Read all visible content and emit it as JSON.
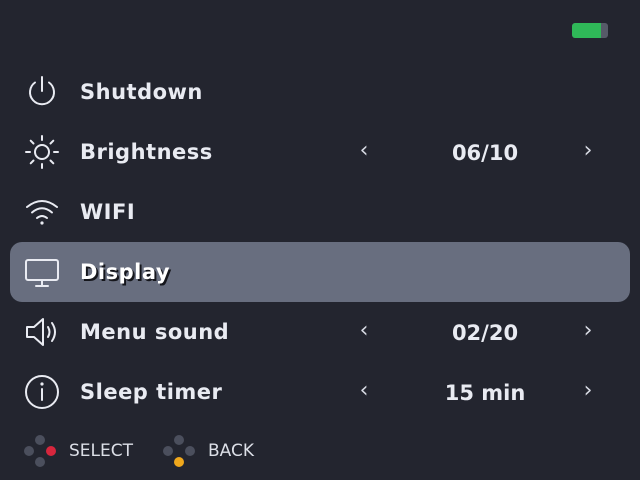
{
  "status": {
    "battery_icon": "battery-icon",
    "battery_level": 0.8,
    "battery_color": "#2fb858"
  },
  "menu": {
    "selected_index": 3,
    "highlight_color": "#686e7f",
    "items": [
      {
        "label": "Shutdown",
        "icon": "power-icon"
      },
      {
        "label": "Brightness",
        "icon": "sun-icon",
        "value": "06/10"
      },
      {
        "label": "WIFI",
        "icon": "wifi-icon"
      },
      {
        "label": "Display",
        "icon": "monitor-icon"
      },
      {
        "label": "Menu sound",
        "icon": "speaker-icon",
        "value": "02/20"
      },
      {
        "label": "Sleep timer",
        "icon": "info-icon",
        "value": "15 min"
      }
    ]
  },
  "footer": {
    "select_label": "SELECT",
    "back_label": "BACK",
    "select_color": "#d7263d",
    "back_color": "#f0a81c"
  }
}
